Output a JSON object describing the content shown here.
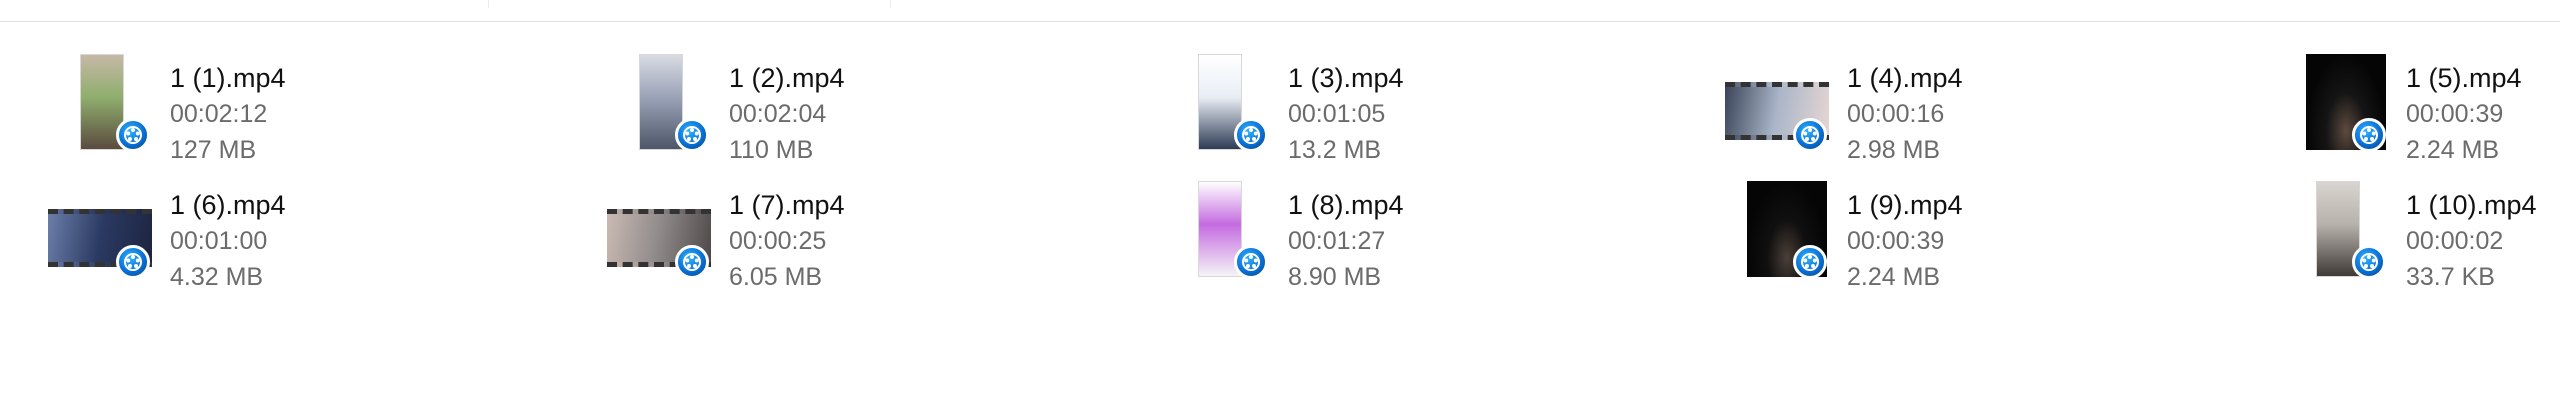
{
  "files": [
    {
      "name": "1 (1).mp4",
      "duration": "00:02:12",
      "size": "127 MB",
      "thumb_style": "portrait",
      "thumb_colors": [
        "#c7b8a6",
        "#5b4b3f",
        "#8fae6d"
      ],
      "icon": "video-file-icon"
    },
    {
      "name": "1 (2).mp4",
      "duration": "00:02:04",
      "size": "110 MB",
      "thumb_style": "portrait",
      "thumb_colors": [
        "#d9dbe3",
        "#4d5669",
        "#9aa3b7"
      ],
      "icon": "video-file-icon"
    },
    {
      "name": "1 (3).mp4",
      "duration": "00:01:05",
      "size": "13.2 MB",
      "thumb_style": "portrait",
      "thumb_colors": [
        "#ffffff",
        "#2d3b55",
        "#e9eef5"
      ],
      "icon": "video-file-icon"
    },
    {
      "name": "1 (4).mp4",
      "duration": "00:00:16",
      "size": "2.98 MB",
      "thumb_style": "landscape",
      "thumb_colors": [
        "#aab6c9",
        "#3b4458",
        "#e6d6d3"
      ],
      "icon": "video-file-icon"
    },
    {
      "name": "1 (5).mp4",
      "duration": "00:00:39",
      "size": "2.24 MB",
      "thumb_style": "dark-portrait",
      "thumb_colors": [
        "#050505",
        "#151515",
        "#5d4a3e"
      ],
      "icon": "video-file-icon"
    },
    {
      "name": "1 (6).mp4",
      "duration": "00:01:00",
      "size": "4.32 MB",
      "thumb_style": "landscape",
      "thumb_colors": [
        "#2b3a63",
        "#6b7fa8",
        "#1d2440"
      ],
      "icon": "video-file-icon"
    },
    {
      "name": "1 (7).mp4",
      "duration": "00:00:25",
      "size": "6.05 MB",
      "thumb_style": "landscape",
      "thumb_colors": [
        "#8f8a8a",
        "#cbbab3",
        "#4f4848"
      ],
      "icon": "video-file-icon"
    },
    {
      "name": "1 (8).mp4",
      "duration": "00:01:27",
      "size": "8.90 MB",
      "thumb_style": "portrait",
      "thumb_colors": [
        "#ffffff",
        "#f4f4f6",
        "#c46be0"
      ],
      "icon": "video-file-icon"
    },
    {
      "name": "1 (9).mp4",
      "duration": "00:00:39",
      "size": "2.24 MB",
      "thumb_style": "dark-portrait",
      "thumb_colors": [
        "#050505",
        "#101010",
        "#4b3f38"
      ],
      "icon": "video-file-icon"
    },
    {
      "name": "1 (10).mp4",
      "duration": "00:00:02",
      "size": "33.7 KB",
      "thumb_style": "portrait",
      "thumb_colors": [
        "#d8d4cf",
        "#3e3a37",
        "#b7b2ab"
      ],
      "icon": "video-file-icon"
    }
  ],
  "badge_icon": "qq-video-badge-icon",
  "badge_color": "#0a6fd6"
}
